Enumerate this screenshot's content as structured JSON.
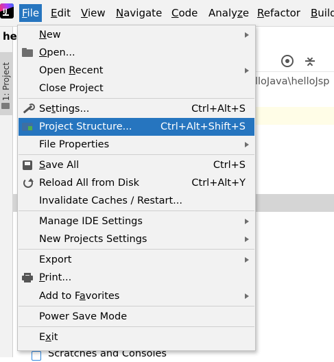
{
  "menubar": {
    "items": [
      {
        "pre": "",
        "mn": "F",
        "post": "ile"
      },
      {
        "pre": "",
        "mn": "E",
        "post": "dit"
      },
      {
        "pre": "",
        "mn": "V",
        "post": "iew"
      },
      {
        "pre": "",
        "mn": "N",
        "post": "avigate"
      },
      {
        "pre": "",
        "mn": "C",
        "post": "ode"
      },
      {
        "pre": "Analy",
        "mn": "z",
        "post": "e"
      },
      {
        "pre": "",
        "mn": "R",
        "post": "efactor"
      },
      {
        "pre": "",
        "mn": "B",
        "post": "uild"
      }
    ]
  },
  "project_title": "hell",
  "sidebar": {
    "project_tab_label": "1: Project"
  },
  "editor": {
    "path_text": "lloJava\\helloJsp"
  },
  "bottom": {
    "scratches_label": "Scratches and Consoles"
  },
  "file_menu": {
    "new": {
      "pre": "",
      "mn": "N",
      "post": "ew"
    },
    "open": {
      "pre": "",
      "mn": "O",
      "post": "pen..."
    },
    "open_recent": {
      "pre": "Open ",
      "mn": "R",
      "post": "ecent"
    },
    "close_project": {
      "pre": "Close Project",
      "mn": "",
      "post": ""
    },
    "settings": {
      "pre": "Se",
      "mn": "t",
      "post": "tings...",
      "shortcut": "Ctrl+Alt+S"
    },
    "project_structure": {
      "pre": "Project Structure...",
      "mn": "",
      "post": "",
      "shortcut": "Ctrl+Alt+Shift+S"
    },
    "file_properties": {
      "pre": "File Properties",
      "mn": "",
      "post": ""
    },
    "save_all": {
      "pre": "",
      "mn": "S",
      "post": "ave All",
      "shortcut": "Ctrl+S"
    },
    "reload": {
      "pre": "Reload All from Disk",
      "mn": "",
      "post": "",
      "shortcut": "Ctrl+Alt+Y"
    },
    "invalidate": {
      "pre": "Invalidate Caches / Restart...",
      "mn": "",
      "post": ""
    },
    "manage_ide": {
      "pre": "Manage IDE Settings",
      "mn": "",
      "post": ""
    },
    "new_projects_settings": {
      "pre": "New Projects Settings",
      "mn": "",
      "post": ""
    },
    "export": {
      "pre": "Export",
      "mn": "",
      "post": ""
    },
    "print": {
      "pre": "",
      "mn": "P",
      "post": "rint..."
    },
    "add_to_favorites": {
      "pre": "Add to F",
      "mn": "a",
      "post": "vorites"
    },
    "power_save": {
      "pre": "Power Save Mode",
      "mn": "",
      "post": ""
    },
    "exit": {
      "pre": "E",
      "mn": "x",
      "post": "it"
    }
  },
  "colors": {
    "highlight": "#2675bf",
    "menu_bg": "#f2f2f2"
  }
}
